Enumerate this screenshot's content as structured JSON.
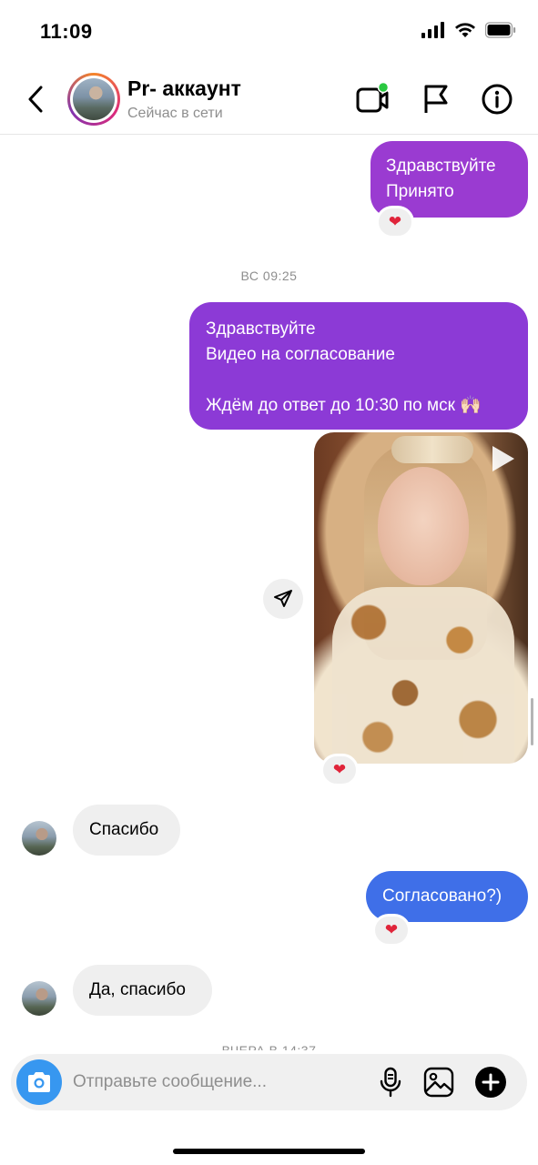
{
  "status_bar": {
    "time": "11:09"
  },
  "header": {
    "contact_name": "Pr- аккаунт",
    "contact_status": "Сейчас в сети"
  },
  "messages": [
    {
      "direction": "out",
      "text": "Здравствуйте\nПринято",
      "reaction": "❤"
    },
    {
      "timestamp": "ВС 09:25"
    },
    {
      "direction": "out",
      "text": "Здравствуйте\nВидео на согласование\n\nЖдём до ответ до 10:30 по мск 🙌🏻"
    },
    {
      "direction": "out",
      "type": "video",
      "reaction": "❤"
    },
    {
      "direction": "in",
      "text": "Спасибо"
    },
    {
      "direction": "out",
      "text": "Согласовано?)",
      "reaction": "❤"
    },
    {
      "direction": "in",
      "text": "Да, спасибо"
    },
    {
      "timestamp": "ВЧЕРА В 14:37"
    }
  ],
  "composer": {
    "placeholder": "Отправьте сообщение..."
  },
  "colors": {
    "bubble_purple": "#9a3bd1",
    "bubble_violet": "#8c3ad6",
    "bubble_blue": "#3f6fe8",
    "bubble_incoming": "#efefef",
    "camera_button": "#3797f0",
    "online_dot": "#2ac840",
    "reaction_heart": "#e0243a"
  },
  "icons": {
    "back": "chevron-left-icon",
    "video_call": "video-call-icon",
    "flag": "flag-icon",
    "info": "info-icon",
    "share": "send-icon",
    "play": "play-icon",
    "camera": "camera-icon",
    "mic": "microphone-icon",
    "gallery": "gallery-icon",
    "plus": "plus-icon"
  }
}
